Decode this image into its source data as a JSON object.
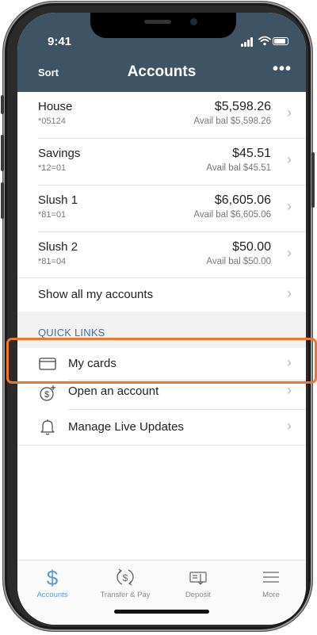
{
  "status": {
    "time": "9:41"
  },
  "nav": {
    "sort_label": "Sort",
    "title": "Accounts",
    "more_label": "•••"
  },
  "accounts": [
    {
      "name": "House",
      "number": "*05124",
      "balance": "$5,598.26",
      "available": "Avail bal $5,598.26"
    },
    {
      "name": "Savings",
      "number": "*12=01",
      "balance": "$45.51",
      "available": "Avail bal $45.51"
    },
    {
      "name": "Slush 1",
      "number": "*81=01",
      "balance": "$6,605.06",
      "available": "Avail bal $6,605.06"
    },
    {
      "name": "Slush 2",
      "number": "*81=04",
      "balance": "$50.00",
      "available": "Avail bal $50.00"
    }
  ],
  "show_all_label": "Show all my accounts",
  "quick_links": {
    "title": "QUICK LINKS",
    "items": [
      {
        "label": "My cards",
        "icon": "credit-card-icon"
      },
      {
        "label": "Open an account",
        "icon": "dollar-plus-icon"
      },
      {
        "label": "Manage Live Updates",
        "icon": "bell-icon"
      }
    ]
  },
  "chevron": "›",
  "tabs": [
    {
      "label": "Accounts",
      "icon": "dollar-icon",
      "active": true
    },
    {
      "label": "Transfer & Pay",
      "icon": "transfer-icon",
      "active": false
    },
    {
      "label": "Deposit",
      "icon": "check-deposit-icon",
      "active": false
    },
    {
      "label": "More",
      "icon": "menu-icon",
      "active": false
    }
  ],
  "colors": {
    "header": "#3e5464",
    "link": "#3b6fb3",
    "active_tab": "#5b9bd5",
    "highlight": "#f0762c"
  }
}
